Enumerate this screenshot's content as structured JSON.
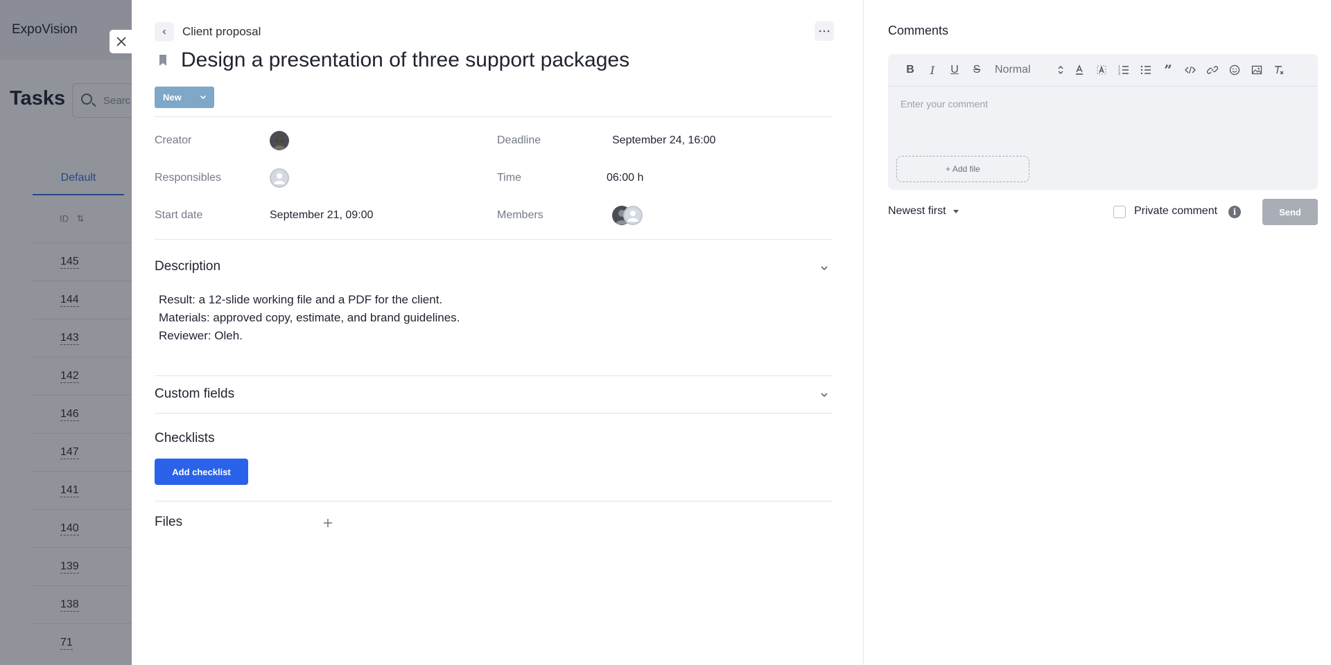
{
  "background": {
    "app_name": "ExpoVision",
    "page_title": "Tasks",
    "search_placeholder": "Searc",
    "view_tab": "Default",
    "id_column_header": "ID",
    "task_ids": [
      "145",
      "144",
      "143",
      "142",
      "146",
      "147",
      "141",
      "140",
      "139",
      "138",
      "71"
    ]
  },
  "task": {
    "breadcrumb": "Client proposal",
    "title": "Design a presentation of three support packages",
    "status": "New",
    "fields": {
      "creator_label": "Creator",
      "responsibles_label": "Responsibles",
      "start_date_label": "Start date",
      "start_date_value": "September 21, 09:00",
      "deadline_label": "Deadline",
      "deadline_value": "September 24, 16:00",
      "time_label": "Time",
      "time_value": "06:00 h",
      "members_label": "Members"
    },
    "description": {
      "title": "Description",
      "lines": [
        "Result: a 12-slide working file and a PDF for the client.",
        "Materials: approved copy, estimate, and brand guidelines.",
        "Reviewer: Oleh."
      ]
    },
    "custom_fields_title": "Custom fields",
    "checklists_title": "Checklists",
    "add_checklist_label": "Add checklist",
    "files_title": "Files"
  },
  "comments": {
    "title": "Comments",
    "format_select": "Normal",
    "placeholder": "Enter your comment",
    "add_file_label": "+ Add file",
    "sort_label": "Newest first",
    "private_label": "Private comment",
    "send_label": "Send"
  },
  "colors": {
    "primary_button": "#2a63e9",
    "status_button": "#7ea7c8",
    "send_disabled": "#a9adb5"
  }
}
